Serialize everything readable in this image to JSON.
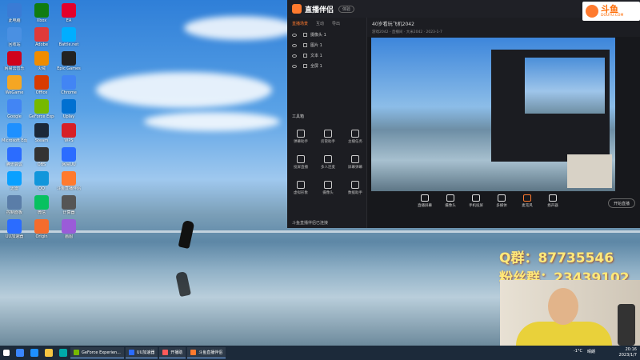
{
  "app": {
    "title": "直播伴侣",
    "badge": "体验",
    "tabs": [
      "直播场景",
      "互动",
      "导出"
    ],
    "sources": [
      "摄像头 1",
      "图片 1",
      "文本 1",
      "全屏 1"
    ],
    "room_title": "40岁看玩飞机2042",
    "room_sub": "游戏2042 - 直播间 · 大米2042 · 2023-1-7",
    "toolbox_title": "工具箱",
    "tools": [
      "弹幕助手",
      "房管助手",
      "主播任务",
      "投屏直播",
      "多人连麦",
      "屏幕弹幕",
      "虚拟形象",
      "摄像头",
      "数据助手"
    ],
    "controls": [
      "直播屏幕",
      "摄像头",
      "手机投屏",
      "多媒体",
      "麦克风",
      "扬声器"
    ],
    "start_label": "开始直播",
    "status": "斗鱼直播伴侣已连接"
  },
  "overlays": {
    "douyu_name": "斗鱼",
    "douyu_sub": "DOUYU.COM",
    "qq_line": "Q群：87735546",
    "fan_line": "粉丝群：23439102"
  },
  "desktop": {
    "icons": [
      "此电脑",
      "回收站",
      "网易云音乐",
      "WeGame",
      "Google",
      "Microsoft Edge",
      "腾讯会议",
      "迅雷",
      "控制面板",
      "UU加速器",
      "Xbox",
      "Adobe",
      "火绒",
      "Office",
      "GeForce Experience",
      "Steam",
      "OBS",
      "QQ",
      "微信",
      "Origin",
      "EA",
      "Battle.net",
      "Epic Games",
      "Chrome",
      "Uplay",
      "WPS",
      "网易UU",
      "斗鱼直播伴侣",
      "计算器",
      "画图"
    ]
  },
  "taskbar": {
    "tasks": [
      {
        "label": "GeForce Experien..."
      },
      {
        "label": "UU加速器"
      },
      {
        "label": "开播助"
      },
      {
        "label": "斗鱼直播伴侣"
      }
    ],
    "tray_temp": "-1°C",
    "tray_weather": "晴朗",
    "time": "20:16",
    "date": "2023/1/7"
  }
}
